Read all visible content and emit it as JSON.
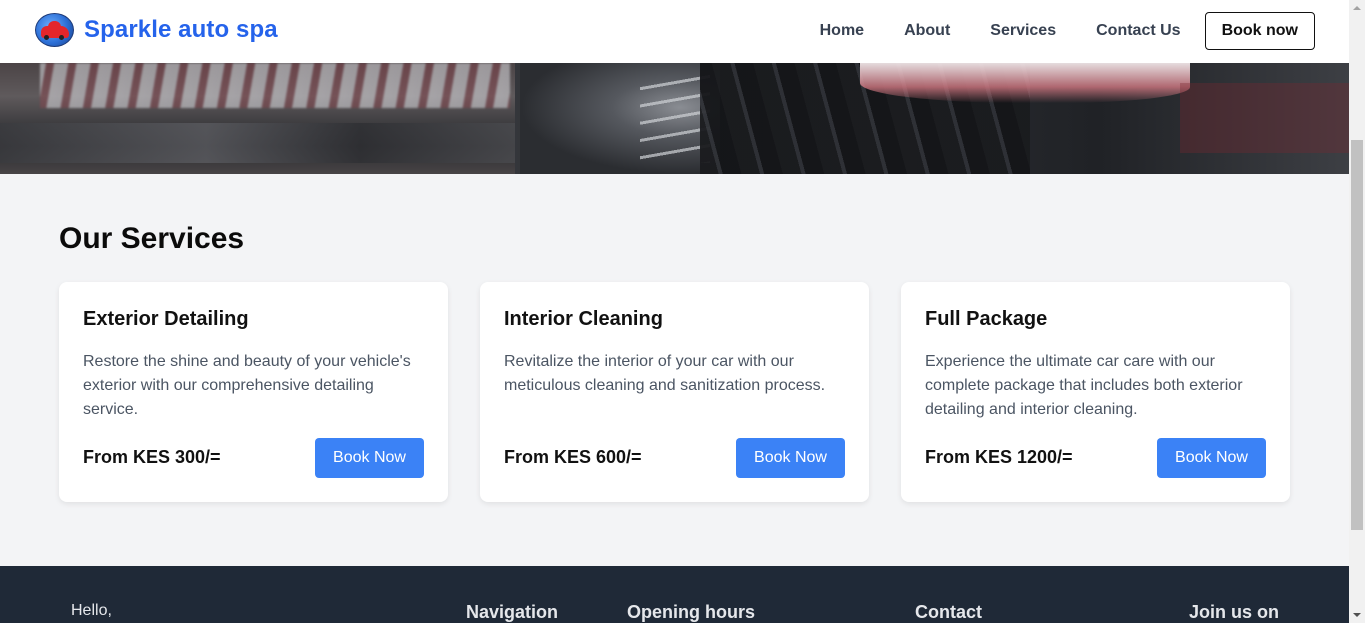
{
  "header": {
    "brand": "Sparkle auto spa",
    "logo_icon": "red-car-logo-icon",
    "nav": [
      "Home",
      "About",
      "Services",
      "Contact Us"
    ],
    "cta": "Book now"
  },
  "hero": {
    "image": "car-wash-foam-tire-photo"
  },
  "services": {
    "title": "Our Services",
    "cards": [
      {
        "title": "Exterior Detailing",
        "description": "Restore the shine and beauty of your vehicle's exterior with our comprehensive detailing service.",
        "price": "From KES 300/=",
        "button": "Book Now"
      },
      {
        "title": "Interior Cleaning",
        "description": "Revitalize the interior of your car with our meticulous cleaning and sanitization process.",
        "price": "From KES 600/=",
        "button": "Book Now"
      },
      {
        "title": "Full Package",
        "description": "Experience the ultimate car care with our complete package that includes both exterior detailing and interior cleaning.",
        "price": "From KES 1200/=",
        "button": "Book Now"
      }
    ]
  },
  "footer": {
    "greeting": "Hello,",
    "headings": [
      "Navigation",
      "Opening hours",
      "Contact",
      "Join us on"
    ]
  },
  "colors": {
    "brand": "#2563eb",
    "button": "#3b82f6",
    "footer_bg": "#1f2937",
    "page_bg": "#f3f4f6"
  }
}
